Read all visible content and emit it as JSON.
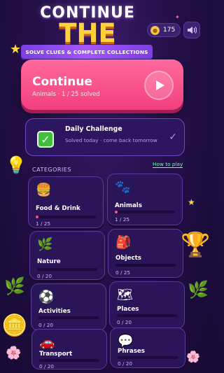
{
  "header": {
    "title_line1": "CONTINUE",
    "title_line2": "THE FUN!",
    "subtitle": "SOLVE CLUES & COMPLETE COLLECTIONS",
    "coins": "175",
    "sound_icon": "speaker-icon"
  },
  "continue": {
    "label": "Continue",
    "subtitle": "Animals · 1 / 25 solved"
  },
  "daily": {
    "title": "Daily Challenge",
    "subtitle": "Solved today · come back tomorrow"
  },
  "categories": {
    "header": "CATEGORIES",
    "how_to_play": "How to play",
    "items": [
      {
        "name": "Food & Drink",
        "icon": "🍔",
        "progress": "1 / 25",
        "fraction": 0.04
      },
      {
        "name": "Animals",
        "icon": "🐾",
        "progress": "1 / 25",
        "fraction": 0.04
      },
      {
        "name": "Nature",
        "icon": "🌿",
        "progress": "0 / 20",
        "fraction": 0
      },
      {
        "name": "Objects",
        "icon": "🎒",
        "progress": "0 / 25",
        "fraction": 0
      },
      {
        "name": "Activities",
        "icon": "⚽",
        "progress": "0 / 20",
        "fraction": 0
      },
      {
        "name": "Places",
        "icon": "🗺",
        "progress": "0 / 20",
        "fraction": 0
      },
      {
        "name": "Transport",
        "icon": "🚗",
        "progress": "0 / 20",
        "fraction": 0
      },
      {
        "name": "Phrases",
        "icon": "💬",
        "progress": "0 / 20",
        "fraction": 0
      }
    ]
  },
  "colors": {
    "accent_pink": "#f23f7e",
    "title_yellow": "#ffd23c",
    "progress_fill": "#ff4e8e",
    "link_green": "#6fffa8"
  }
}
